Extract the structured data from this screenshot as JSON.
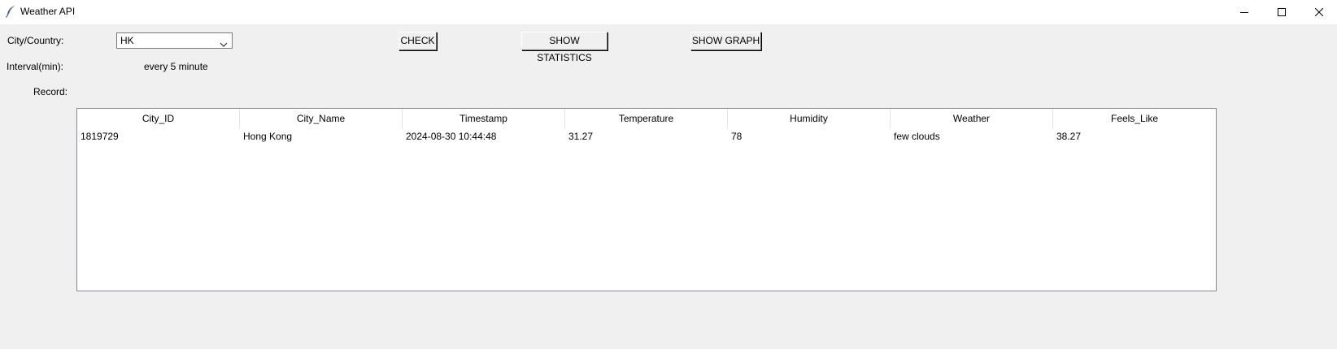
{
  "window": {
    "title": "Weather API",
    "controls": [
      "minimize-icon",
      "maximize-icon",
      "close-icon"
    ]
  },
  "form": {
    "city_label": "City/Country:",
    "city_value": "HK",
    "interval_label": "Interval(min):",
    "interval_value": "every 5 minute",
    "record_label": "Record:"
  },
  "buttons": {
    "check": "CHECK",
    "show_statistics": "SHOW STATISTICS",
    "show_graph": "SHOW GRAPH"
  },
  "table": {
    "columns": [
      "City_ID",
      "City_Name",
      "Timestamp",
      "Temperature",
      "Humidity",
      "Weather",
      "Feels_Like"
    ],
    "rows": [
      [
        "1819729",
        "Hong Kong",
        "2024-08-30 10:44:48",
        "31.27",
        "78",
        "few clouds",
        "38.27"
      ]
    ]
  },
  "colors": {
    "window_bg": "#f0f0f0",
    "titlebar_bg": "#ffffff",
    "table_border": "#828790"
  }
}
